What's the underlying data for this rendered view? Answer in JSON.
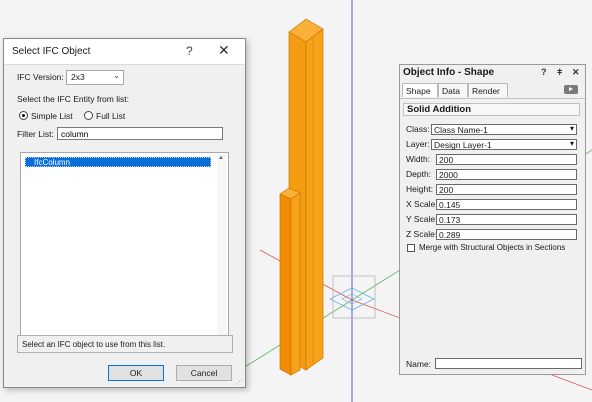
{
  "ifc_dialog": {
    "title": "Select IFC Object",
    "help_glyph": "?",
    "close_glyph": "✕",
    "version_label": "IFC Version:",
    "version_value": "2x3",
    "select_label": "Select the IFC Entity from list:",
    "radio_simple": "Simple List",
    "radio_full": "Full List",
    "selected_radio": "Simple List",
    "filter_label": "Filter List:",
    "filter_value": "column",
    "list_items": [
      "IfcColumn"
    ],
    "status_text": "Select an IFC object to use from this list.",
    "ok_label": "OK",
    "cancel_label": "Cancel"
  },
  "object_info": {
    "title": "Object Info - Shape",
    "title_icons": [
      "?",
      "ǂ",
      "✕"
    ],
    "tabs": [
      "Shape",
      "Data",
      "Render"
    ],
    "active_tab": "Shape",
    "section": "Solid Addition",
    "class_label": "Class:",
    "class_value": "Class Name-1",
    "layer_label": "Layer:",
    "layer_value": "Design Layer-1",
    "width_label": "Width:",
    "width_value": "200",
    "depth_label": "Depth:",
    "depth_value": "2000",
    "height_label": "Height:",
    "height_value": "200",
    "xscale_label": "X Scale:",
    "xscale_value": "0.145",
    "yscale_label": "Y Scale:",
    "yscale_value": "0.173",
    "zscale_label": "Z Scale:",
    "zscale_value": "0.289",
    "merge_label": "Merge with Structural Objects in Sections",
    "merge_checked": false,
    "name_label": "Name:",
    "name_value": ""
  },
  "colors": {
    "column_fill": "#f7a21b",
    "column_edge": "#c97400",
    "selection_blue": "#0a6fd8",
    "axis_red": "#d9534f",
    "axis_green": "#5cb85c",
    "axis_blue": "#4a64d6"
  }
}
